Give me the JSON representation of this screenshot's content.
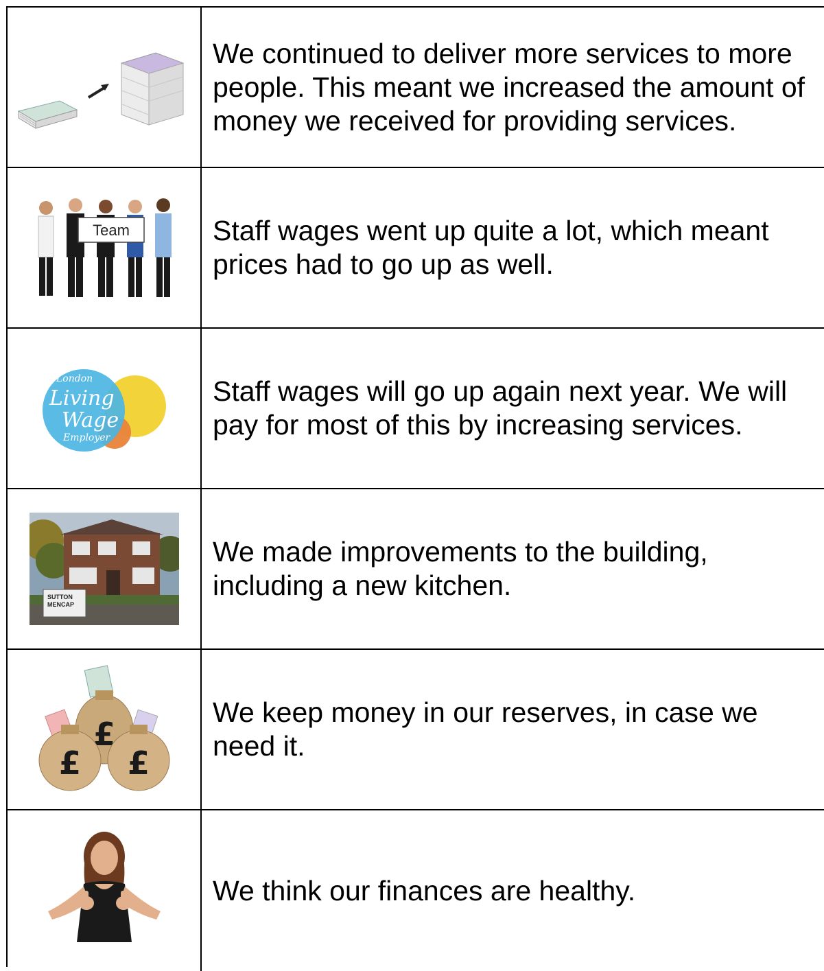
{
  "rows": [
    {
      "text": "We continued to deliver more services to more people. This meant we increased the amount of money we received for providing services.",
      "image": "money-increase-icon"
    },
    {
      "text": "Staff wages went up quite a lot, which meant prices had to go up as well.",
      "image": "team-staff-photo",
      "sign": "Team"
    },
    {
      "text": "Staff wages will go up again next year. We will pay for most of this by increasing services.",
      "image": "london-living-wage-logo",
      "logo": {
        "line1": "London",
        "line2": "Living",
        "line3": "Wage",
        "line4": "Employer"
      }
    },
    {
      "text": "We made improvements to the building, including a new kitchen.",
      "image": "building-photo",
      "sign": {
        "line1": "SUTTON",
        "line2": "MENCAP"
      }
    },
    {
      "text": "We keep money in our reserves, in case we need it.",
      "image": "money-bags-icon",
      "symbol": "£"
    },
    {
      "text": "We think our finances are healthy.",
      "image": "thumbs-up-woman-photo"
    }
  ],
  "colors": {
    "border": "#000000",
    "logo_blue": "#4cb5e3",
    "logo_yellow": "#f2d43a",
    "logo_orange": "#e8833a"
  }
}
